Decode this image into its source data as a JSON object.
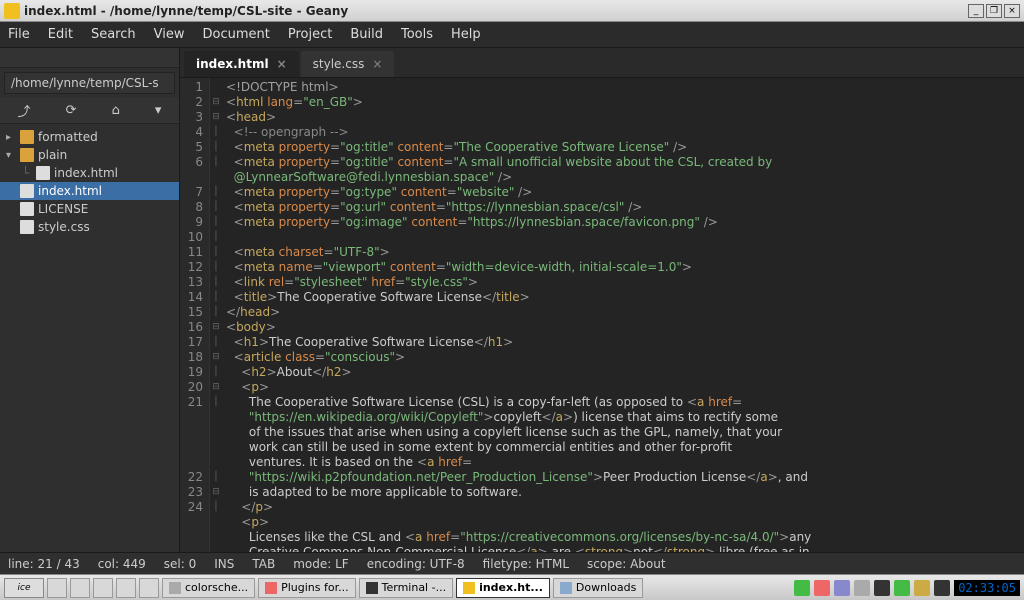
{
  "window": {
    "title": "index.html - /home/lynne/temp/CSL-site - Geany"
  },
  "menu": [
    "File",
    "Edit",
    "Search",
    "View",
    "Document",
    "Project",
    "Build",
    "Tools",
    "Help"
  ],
  "sidebar": {
    "path": "/home/lynne/temp/CSL-s",
    "tree": [
      {
        "type": "folder",
        "label": "formatted",
        "expanded": false,
        "nested": false
      },
      {
        "type": "folder",
        "label": "plain",
        "expanded": true,
        "nested": false
      },
      {
        "type": "file",
        "label": "index.html",
        "nested": true,
        "selected": false
      },
      {
        "type": "file",
        "label": "index.html",
        "nested": false,
        "selected": true
      },
      {
        "type": "file",
        "label": "LICENSE",
        "nested": false,
        "selected": false
      },
      {
        "type": "file",
        "label": "style.css",
        "nested": false,
        "selected": false
      }
    ]
  },
  "tabs": [
    {
      "label": "index.html",
      "active": true
    },
    {
      "label": "style.css",
      "active": false
    }
  ],
  "code": {
    "first_line": 1,
    "last_line": 24,
    "content_summary": "HTML document: DOCTYPE, <html lang=en_GB>, <head> with OpenGraph meta tags (og:title 'The Cooperative Software License', og:title description about CSL by @LynnearSoftware@fedi.lynnesbian.space, og:type website, og:url https://lynnesbian.space/csl, og:image favicon.png), charset UTF-8, viewport meta, stylesheet link style.css, <title>The Cooperative Software License</title>. <body> with <h1>, <article class=conscious>, <h2>About</h2>, paragraph about CSL copy-far-left license linking to Wikipedia Copyleft and Peer Production License pages, second paragraph linking creativecommons.org by-nc-sa/4.0."
  },
  "status": {
    "line": "line: 21 / 43",
    "col": "col: 449",
    "sel": "sel: 0",
    "ins": "INS",
    "tab": "TAB",
    "mode": "mode: LF",
    "encoding": "encoding: UTF-8",
    "filetype": "filetype: HTML",
    "scope": "scope: About"
  },
  "taskbar": {
    "items": [
      {
        "label": "colorsche...",
        "active": false
      },
      {
        "label": "Plugins for...",
        "active": false
      },
      {
        "label": "Terminal -...",
        "active": false
      },
      {
        "label": "index.ht...",
        "active": true
      },
      {
        "label": "Downloads",
        "active": false
      }
    ],
    "clock": "02:33:05"
  }
}
